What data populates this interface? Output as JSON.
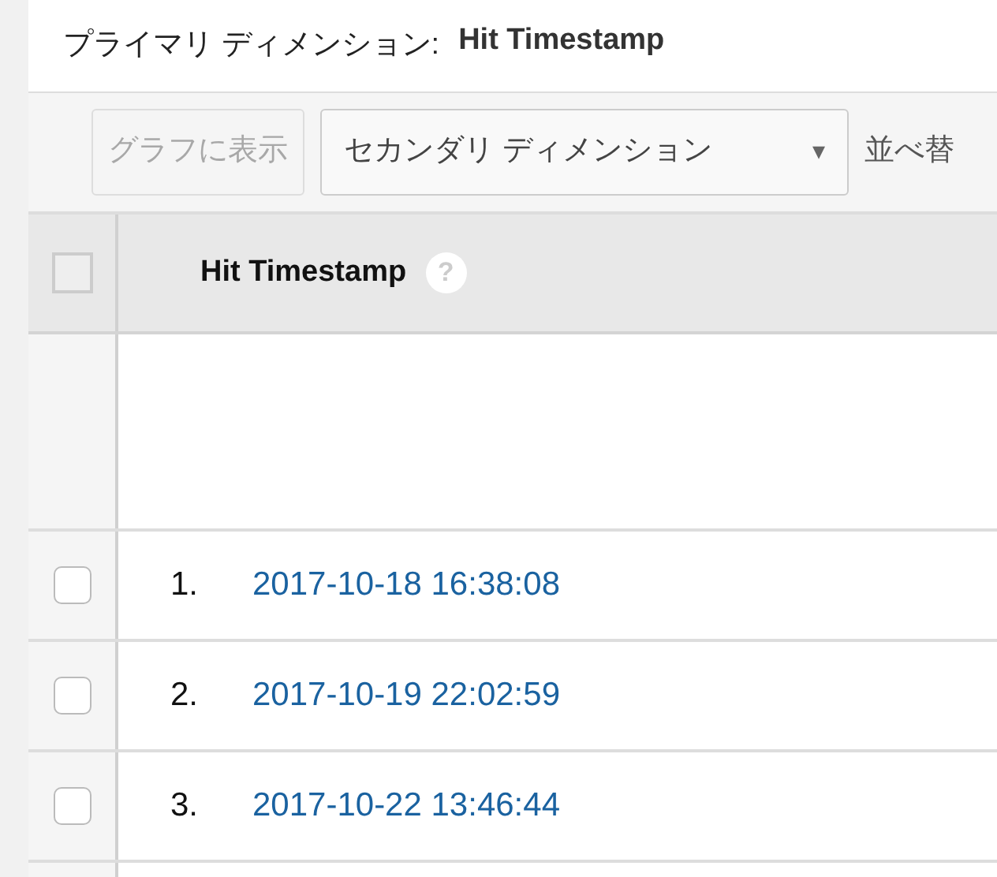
{
  "primary_dimension": {
    "label": "プライマリ ディメンション:",
    "value": "Hit Timestamp"
  },
  "toolbar": {
    "chart_button": {
      "label": "グラフに表示",
      "disabled": true
    },
    "secondary_dimension": {
      "label": "セカンダリ ディメンション",
      "caret": "▾"
    },
    "sort_label": "並べ替"
  },
  "table": {
    "select_all": {
      "checked": false
    },
    "columns": [
      {
        "label": "Hit Timestamp",
        "help": "?"
      }
    ],
    "rows": [
      {
        "index": "1.",
        "value": "2017-10-18 16:38:08",
        "checked": false
      },
      {
        "index": "2.",
        "value": "2017-10-19 22:02:59",
        "checked": false
      },
      {
        "index": "3.",
        "value": "2017-10-22 13:46:44",
        "checked": false
      }
    ]
  }
}
